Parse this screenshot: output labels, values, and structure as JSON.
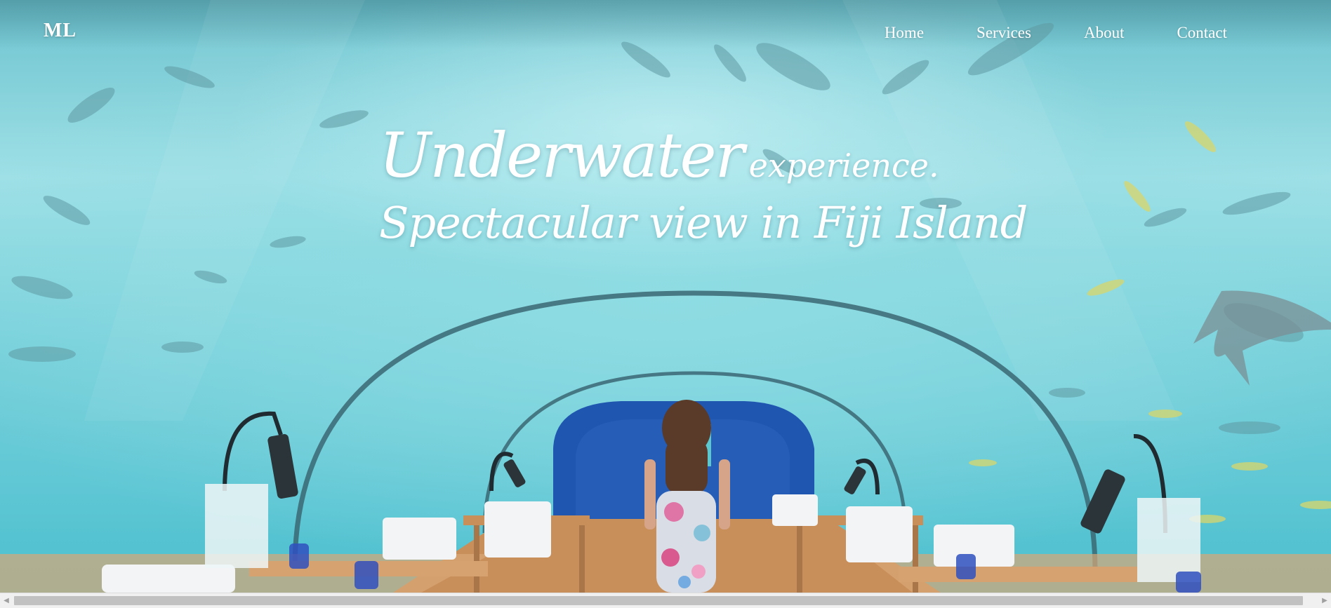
{
  "brand": {
    "logo": "ML"
  },
  "nav": {
    "items": [
      {
        "label": "Home"
      },
      {
        "label": "Services"
      },
      {
        "label": "About"
      },
      {
        "label": "Contact"
      }
    ]
  },
  "hero": {
    "headline_big": "Underwater",
    "headline_small": "experience.",
    "subheadline": "Spectacular view in Fiji Island"
  },
  "scrollbar": {
    "left_arrow_icon": "chevron-left-icon",
    "right_arrow_icon": "chevron-right-icon",
    "left_arrow": "◀",
    "right_arrow": "▶"
  },
  "colors": {
    "text": "#ffffff",
    "water": "#7fd2dc",
    "tunnel_blue": "#1f56b0",
    "table_wood": "#c98f5a"
  }
}
